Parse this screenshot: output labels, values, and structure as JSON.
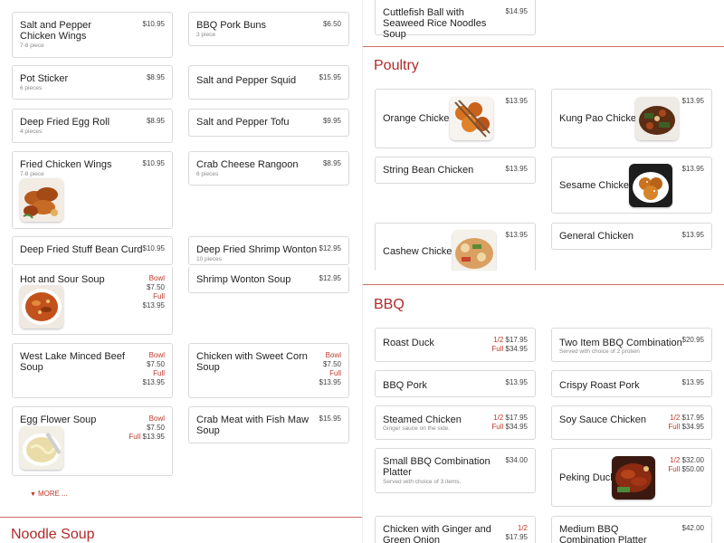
{
  "left": {
    "more_label": "MORE ...",
    "next_section": "Noodle Soup",
    "items": {
      "salt_pepper_wings": {
        "name": "Salt and Pepper Chicken Wings",
        "desc": "7-8 piece",
        "price": "$10.95"
      },
      "bbq_pork_buns": {
        "name": "BBQ Pork Buns",
        "desc": "3 piece",
        "price": "$6.50"
      },
      "pot_sticker": {
        "name": "Pot Sticker",
        "desc": "6 pieces",
        "price": "$8.95"
      },
      "salt_pepper_squid": {
        "name": "Salt and Pepper Squid",
        "price": "$15.95"
      },
      "egg_roll": {
        "name": "Deep Fried Egg Roll",
        "desc": "4 pieces",
        "price": "$8.95"
      },
      "salt_pepper_tofu": {
        "name": "Salt and Pepper Tofu",
        "price": "$9.95"
      },
      "fried_wings": {
        "name": "Fried Chicken Wings",
        "desc": "7-8 piece",
        "price": "$10.95"
      },
      "crab_rangoon": {
        "name": "Crab Cheese Rangoon",
        "desc": "6 pieces",
        "price": "$8.95"
      },
      "bean_curd": {
        "name": "Deep Fried Stuff Bean Curd",
        "price": "$10.95"
      },
      "shrimp_wonton_fried": {
        "name": "Deep Fried Shrimp Wonton",
        "desc": "10 pieces",
        "price": "$12.95"
      },
      "hot_sour": {
        "name": "Hot and Sour Soup",
        "bowl_label": "Bowl",
        "bowl_price": "$7.50",
        "full_label": "Full",
        "full_price": "$13.95"
      },
      "shrimp_wonton_soup": {
        "name": "Shrimp Wonton Soup",
        "price": "$12.95"
      },
      "west_lake": {
        "name": "West Lake Minced Beef Soup",
        "bowl_label": "Bowl",
        "bowl_price": "$7.50",
        "full_label": "Full",
        "full_price": "$13.95"
      },
      "sweet_corn": {
        "name": "Chicken with Sweet Corn Soup",
        "bowl_label": "Bowl",
        "bowl_price": "$7.50",
        "full_label": "Full",
        "full_price": "$13.95"
      },
      "egg_flower": {
        "name": "Egg Flower Soup",
        "bowl_label": "Bowl",
        "bowl_price": "$7.50",
        "full_label": "Full",
        "full_price": "$13.95"
      },
      "crab_fish_maw": {
        "name": "Crab Meat with Fish Maw Soup",
        "price": "$15.95"
      }
    }
  },
  "right": {
    "cuttlefish": {
      "name": "Cuttlefish Ball with Seaweed Rice Noodles Soup",
      "price": "$14.95"
    },
    "poultry": {
      "title": "Poultry",
      "orange": {
        "name": "Orange Chicken",
        "price": "$13.95"
      },
      "kung_pao": {
        "name": "Kung Pao Chicken",
        "price": "$13.95"
      },
      "string_bean": {
        "name": "String Bean Chicken",
        "price": "$13.95"
      },
      "sesame": {
        "name": "Sesame Chicken",
        "price": "$13.95"
      },
      "cashew": {
        "name": "Cashew Chicken",
        "price": "$13.95"
      },
      "general": {
        "name": "General Chicken",
        "price": "$13.95"
      }
    },
    "bbq": {
      "title": "BBQ",
      "roast_duck": {
        "name": "Roast Duck",
        "half_label": "1/2",
        "half_price": "$17.95",
        "full_label": "Full",
        "full_price": "$34.95"
      },
      "two_item": {
        "name": "Two Item BBQ Combination",
        "desc": "Served with choice of 2 protein",
        "price": "$20.95"
      },
      "bbq_pork": {
        "name": "BBQ Pork",
        "price": "$13.95"
      },
      "crispy_pork": {
        "name": "Crispy Roast Pork",
        "price": "$13.95"
      },
      "steamed_chicken": {
        "name": "Steamed Chicken",
        "desc": "Ginger sauce on the side.",
        "half_label": "1/2",
        "half_price": "$17.95",
        "full_label": "Full",
        "full_price": "$34.95"
      },
      "soy_sauce": {
        "name": "Soy Sauce Chicken",
        "half_label": "1/2",
        "half_price": "$17.95",
        "full_label": "Full",
        "full_price": "$34.95"
      },
      "small_combo": {
        "name": "Small BBQ Combination Platter",
        "desc": "Served with choice of 3 items.",
        "price": "$34.00"
      },
      "peking_duck": {
        "name": "Peking Duck",
        "half_label": "1/2",
        "half_price": "$32.00",
        "full_label": "Full",
        "full_price": "$50.00"
      },
      "ginger_onion": {
        "name": "Chicken with Ginger and Green Onion",
        "half_label": "1/2",
        "half_price": "$17.95"
      },
      "medium_combo": {
        "name": "Medium BBQ Combination Platter",
        "price": "$42.00"
      }
    }
  },
  "colors": {
    "accent": "#b22a2a",
    "label_red": "#c0392b",
    "border": "#d9d9d9"
  }
}
